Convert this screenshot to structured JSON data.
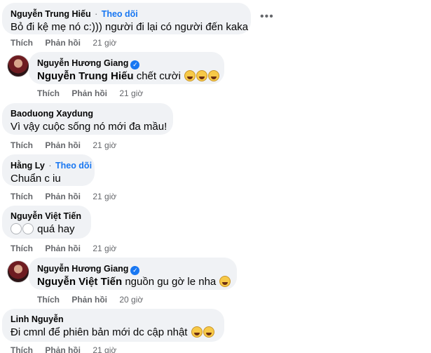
{
  "comments": [
    {
      "name": "Nguyễn Trung Hiếu",
      "follow": "Theo dõi",
      "text": "Bỏ đi kệ mẹ nó c:))) người đi lại có người đến kaka",
      "like": "Thích",
      "reply": "Phản hồi",
      "time": "21 giờ"
    },
    {
      "name": "Nguyễn Hương Giang",
      "mention": "Nguyễn Trung Hiếu",
      "text": "chết cười",
      "like": "Thích",
      "reply": "Phản hồi",
      "time": "21 giờ"
    },
    {
      "name": "Baoduong Xaydung",
      "text": "Vì vậy cuộc sống nó mới đa mầu!",
      "like": "Thích",
      "reply": "Phản hồi",
      "time": "21 giờ"
    },
    {
      "name": "Hằng Ly",
      "follow": "Theo dõi",
      "text": "Chuẩn c iu",
      "like": "Thích",
      "reply": "Phản hồi",
      "time": "21 giờ"
    },
    {
      "name": "Nguyễn Việt Tiến",
      "text": "quá hay",
      "like": "Thích",
      "reply": "Phản hồi",
      "time": "21 giờ"
    },
    {
      "name": "Nguyễn Hương Giang",
      "mention": "Nguyễn Việt Tiến",
      "text": "nguồn gu gờ le nha",
      "like": "Thích",
      "reply": "Phản hồi",
      "time": "20 giờ"
    },
    {
      "name": "Linh Nguyễn",
      "text": "Đi cmnl để phiên bản mới dc cập nhật",
      "like": "Thích",
      "reply": "Phản hồi",
      "time": "21 giờ"
    }
  ],
  "more_icon": "more-horizontal-icon",
  "colors": {
    "bubble": "#f0f2f5",
    "link": "#1877f2",
    "meta": "#65676b"
  }
}
